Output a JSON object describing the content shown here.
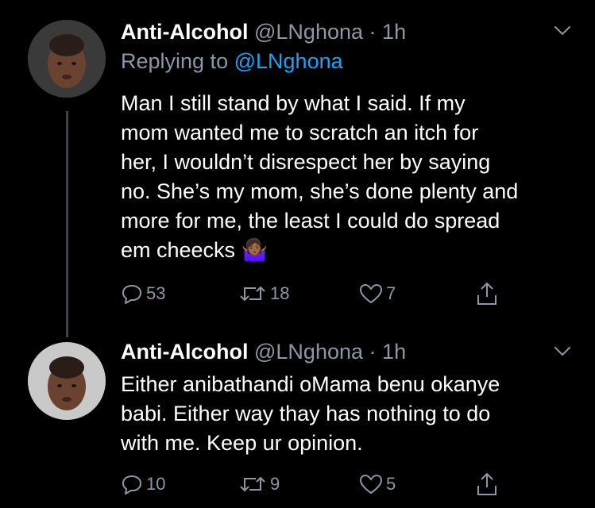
{
  "tweets": [
    {
      "name": "Anti-Alcohol",
      "handle": "@LNghona",
      "sep": "·",
      "time": "1h",
      "replying_prefix": "Replying to",
      "replying_to": "@LNghona",
      "lines": [
        "Man I still stand by what I said. If my",
        "mom wanted me to scratch an itch for",
        "her, I wouldn’t disrespect her by saying",
        "no. She’s my mom, she’s done plenty and",
        "more for me, the least I could do spread",
        "em cheecks 🤷🏾‍♀️"
      ],
      "reply_count": "53",
      "retweet_count": "18",
      "like_count": "7"
    },
    {
      "name": "Anti-Alcohol",
      "handle": "@LNghona",
      "sep": "·",
      "time": "1h",
      "lines": [
        "Either anibathandi oMama benu okanye",
        "babi. Either way thay has nothing to do",
        "with me. Keep ur opinion."
      ],
      "reply_count": "10",
      "retweet_count": "9",
      "like_count": "5"
    }
  ],
  "icons": {
    "reply": "reply-icon",
    "retweet": "retweet-icon",
    "like": "heart-icon",
    "share": "share-icon",
    "menu": "chevron-down-icon"
  },
  "colors": {
    "background": "#000000",
    "text": "#ffffff",
    "muted": "#8b98a5",
    "link": "#1da1f2"
  }
}
